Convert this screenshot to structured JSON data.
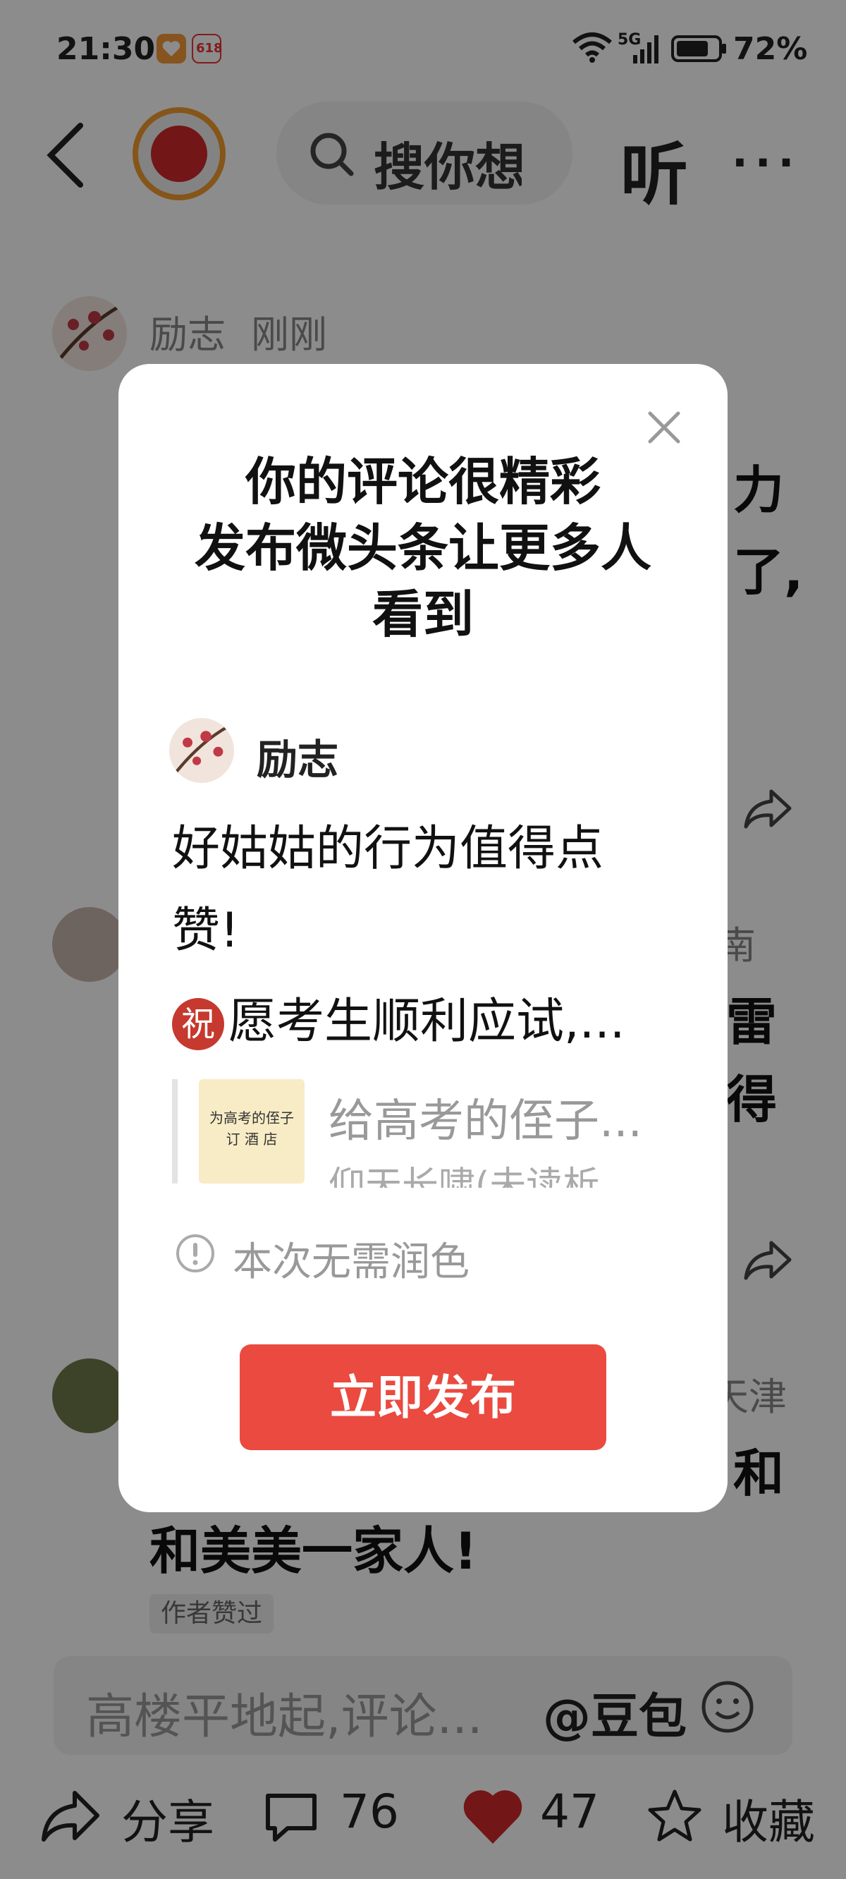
{
  "status_bar": {
    "time": "21:30",
    "network": "5G",
    "battery": "72%",
    "app_badge": "618"
  },
  "header": {
    "search_placeholder": "搜你想",
    "listen_label": "听",
    "more_label": "···"
  },
  "comments": [
    {
      "author": "励志",
      "time": "刚刚",
      "right_text_1": "力",
      "right_text_2": "了,"
    },
    {
      "right_meta": "南",
      "right_text_1": "雷",
      "right_text_2": "得"
    },
    {
      "right_meta": "天津",
      "right_text_1": "和",
      "line": "和美美一家人!",
      "badge": "作者赞过"
    }
  ],
  "comment_input": {
    "placeholder": "高楼平地起,评论...",
    "at_label": "@豆包"
  },
  "bottom_bar": {
    "share_label": "分享",
    "comment_count": "76",
    "like_count": "47",
    "favorite_label": "收藏"
  },
  "modal": {
    "title_line1": "你的评论很精彩",
    "title_line2": "发布微头条让更多人",
    "title_line3": "看到",
    "author": "励志",
    "body_line1": "好姑姑的行为值得点",
    "body_line2": "赞!",
    "zhu_glyph": "祝",
    "body_line3": "愿考生顺利应试,...",
    "thumb_line1": "为高考的侄子",
    "thumb_line2": "订 酒 店",
    "quote_title": "给高考的侄子...",
    "quote_sub": "仰天长啸(未读析",
    "info_text": "本次无需润色",
    "publish_label": "立即发布"
  },
  "colors": {
    "accent_red": "#ea4a3f",
    "like_red": "#d0282a"
  }
}
